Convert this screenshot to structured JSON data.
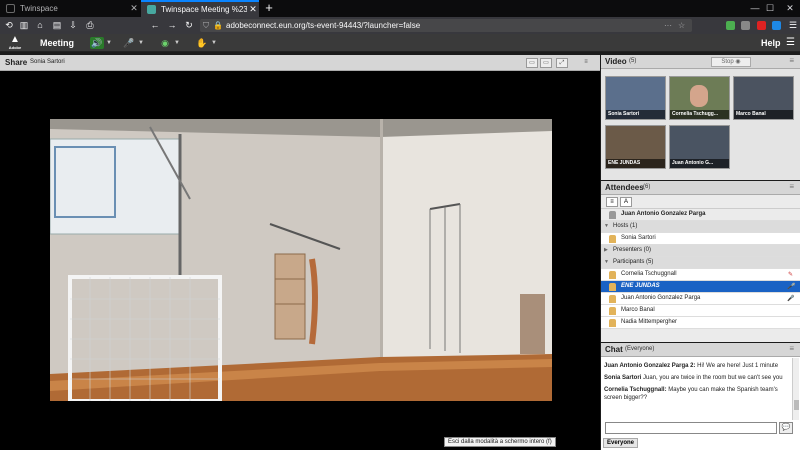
{
  "browser": {
    "tabs": [
      {
        "label": "Twinspace"
      },
      {
        "label": "Twinspace Meeting %2394443"
      }
    ],
    "url": "adobeconnect.eun.org/ts-event-94443/?launcher=false"
  },
  "adobe_menu": {
    "logo_text": "Adobe",
    "meeting_label": "Meeting",
    "help_label": "Help"
  },
  "share": {
    "title": "Share",
    "presenter": "Sonia Sartori",
    "tooltip": "Esci dalla modalità a schermo intero (f)"
  },
  "video": {
    "title": "Video",
    "count": "(5)",
    "stop_label": "Stop",
    "tiles": [
      {
        "name": "Sonia Sartori"
      },
      {
        "name": "Cornelia Tschugg..."
      },
      {
        "name": "Marco Banal"
      },
      {
        "name": "ENE JUNDAS"
      },
      {
        "name": "Juan Antonio G..."
      }
    ]
  },
  "attendees": {
    "title": "Attendees",
    "count": "(6)",
    "me": "Juan Antonio Gonzalez Parga",
    "hosts_label": "Hosts (1)",
    "hosts": [
      "Sonia Sartori"
    ],
    "presenters_label": "Presenters (0)",
    "participants_label": "Participants (5)",
    "participants": [
      "Cornelia Tschuggnall",
      "ENE JUNDAS",
      "Juan Antonio Gonzalez Parga",
      "Marco Banal",
      "Nadia Mittempergher"
    ]
  },
  "chat": {
    "title": "Chat",
    "audience": "(Everyone)",
    "messages": [
      {
        "sender": "Juan Antonio Gonzalez Parga 2:",
        "text": " Hi! We are here! Just 1 minute"
      },
      {
        "sender": "Sonia Sartori",
        "text": " Juan, you are twice in the room but we can't see you"
      },
      {
        "sender": "Cornelia Tschuggnall:",
        "text": " Maybe you can make the Spanish team's screen bigger??"
      }
    ],
    "tab_label": "Everyone"
  }
}
